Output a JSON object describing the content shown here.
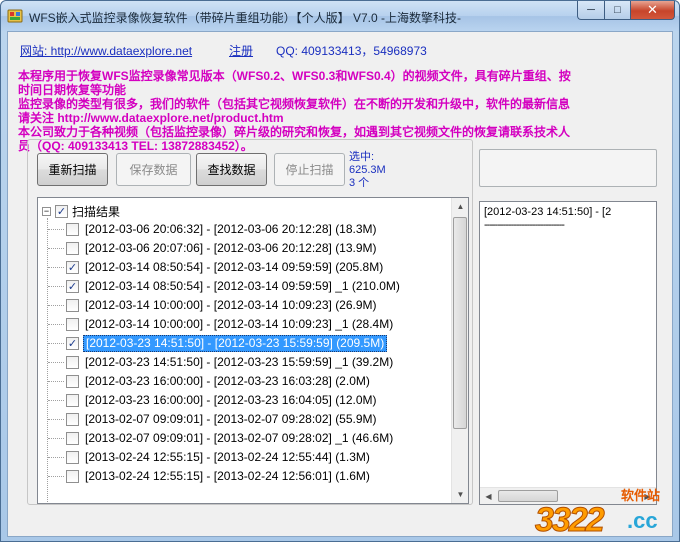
{
  "window": {
    "title": "WFS嵌入式监控录像恢复软件（带碎片重组功能）【个人版】 V7.0  -上海数擎科技-",
    "min_glyph": "─",
    "max_glyph": "□",
    "close_glyph": "✕"
  },
  "header": {
    "site_link": "网站: http://www.dataexplore.net",
    "register_link": "注册",
    "qq": "QQ: 409133413，54968973"
  },
  "intro": {
    "lines": [
      "本程序用于恢复WFS监控录像常见版本（WFS0.2、WFS0.3和WFS0.4）的视频文件，具有碎片重组、按",
      "时间日期恢复等功能",
      "监控录像的类型有很多，我们的软件（包括其它视频恢复软件）在不断的开发和升级中，软件的最新信息",
      "请关注 http://www.dataexplore.net/product.htm",
      "本公司致力于各种视频（包括监控录像）碎片级的研究和恢复，如遇到其它视频文件的恢复请联系技术人",
      "员（QQ: 409133413 TEL: 13872883452）。"
    ]
  },
  "toolbar": {
    "rescan": "重新扫描",
    "save": "保存数据",
    "find": "查找数据",
    "stop": "停止扫描"
  },
  "selection": {
    "label": "选中:",
    "size": "625.3M",
    "count": "3 个"
  },
  "tree": {
    "root_label": "扫描结果",
    "root_checked": true,
    "expander": "−",
    "rows": [
      {
        "text": "[2012-03-06 20:06:32] - [2012-03-06 20:12:28] (18.3M)",
        "checked": false,
        "selected": false
      },
      {
        "text": "[2012-03-06 20:07:06] - [2012-03-06 20:12:28] (13.9M)",
        "checked": false,
        "selected": false
      },
      {
        "text": "[2012-03-14 08:50:54] - [2012-03-14 09:59:59] (205.8M)",
        "checked": true,
        "selected": false
      },
      {
        "text": "[2012-03-14 08:50:54] - [2012-03-14 09:59:59] _1 (210.0M)",
        "checked": true,
        "selected": false
      },
      {
        "text": "[2012-03-14 10:00:00] - [2012-03-14 10:09:23] (26.9M)",
        "checked": false,
        "selected": false
      },
      {
        "text": "[2012-03-14 10:00:00] - [2012-03-14 10:09:23] _1 (28.4M)",
        "checked": false,
        "selected": false
      },
      {
        "text": "[2012-03-23 14:51:50] - [2012-03-23 15:59:59] (209.5M)",
        "checked": true,
        "selected": true
      },
      {
        "text": "[2012-03-23 14:51:50] - [2012-03-23 15:59:59] _1 (39.2M)",
        "checked": false,
        "selected": false
      },
      {
        "text": "[2012-03-23 16:00:00] - [2012-03-23 16:03:28] (2.0M)",
        "checked": false,
        "selected": false
      },
      {
        "text": "[2012-03-23 16:00:00] - [2012-03-23 16:04:05] (12.0M)",
        "checked": false,
        "selected": false
      },
      {
        "text": "[2013-02-07 09:09:01] - [2013-02-07 09:28:02] (55.9M)",
        "checked": false,
        "selected": false
      },
      {
        "text": "[2013-02-07 09:09:01] - [2013-02-07 09:28:02] _1 (46.6M)",
        "checked": false,
        "selected": false
      },
      {
        "text": "[2013-02-24 12:55:15] - [2013-02-24 12:55:44] (1.3M)",
        "checked": false,
        "selected": false
      },
      {
        "text": "[2013-02-24 12:55:15] - [2013-02-24 12:56:01] (1.6M)",
        "checked": false,
        "selected": false
      }
    ]
  },
  "detail": {
    "first_line": "[2012-03-23 14:51:50] - [2",
    "separator": "------------------------------"
  },
  "watermark": {
    "site": "软件站",
    "number": "3322",
    "domain": ".cc"
  }
}
